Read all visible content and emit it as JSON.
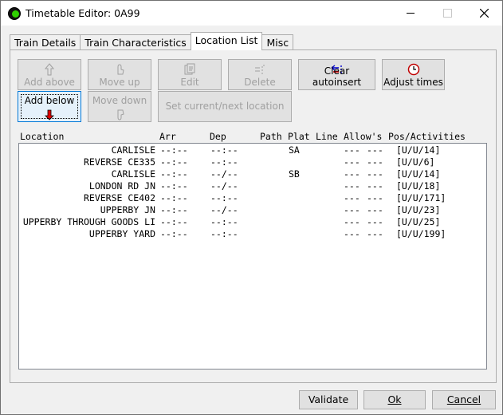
{
  "window": {
    "title": "Timetable Editor: 0A99"
  },
  "tabs": [
    {
      "label": "Train Details",
      "active": false
    },
    {
      "label": "Train Characteristics",
      "active": false
    },
    {
      "label": "Location List",
      "active": true
    },
    {
      "label": "Misc",
      "active": false
    }
  ],
  "toolbar": {
    "add_above": "Add above",
    "move_up": "Move up",
    "edit": "Edit",
    "delete": "Delete",
    "clear_autoinsert": "Clear autoinsert",
    "adjust_times": "Adjust times",
    "add_below": "Add below",
    "move_down": "Move down",
    "set_location": "Set current/next location"
  },
  "list": {
    "headers": {
      "location": "Location",
      "arr": "Arr",
      "dep": "Dep",
      "path": "Path",
      "plat": "Plat",
      "line": "Line",
      "allows": "Allow's",
      "pos": "Pos/Activities"
    },
    "rows": [
      {
        "location": "CARLISLE",
        "arr": "--:--",
        "dep": "--:--",
        "plat": "SA",
        "allow1": "---",
        "allow2": "---",
        "pos": "[U/U/14]"
      },
      {
        "location": "REVERSE CE335",
        "arr": "--:--",
        "dep": "--:--",
        "plat": "",
        "allow1": "---",
        "allow2": "---",
        "pos": "[U/U/6]"
      },
      {
        "location": "CARLISLE",
        "arr": "--:--",
        "dep": "--/--",
        "plat": "SB",
        "allow1": "---",
        "allow2": "---",
        "pos": "[U/U/14]"
      },
      {
        "location": "LONDON RD JN",
        "arr": "--:--",
        "dep": "--/--",
        "plat": "",
        "allow1": "---",
        "allow2": "---",
        "pos": "[U/U/18]"
      },
      {
        "location": "REVERSE CE402",
        "arr": "--:--",
        "dep": "--:--",
        "plat": "",
        "allow1": "---",
        "allow2": "---",
        "pos": "[U/U/171]"
      },
      {
        "location": "UPPERBY JN",
        "arr": "--:--",
        "dep": "--/--",
        "plat": "",
        "allow1": "---",
        "allow2": "---",
        "pos": "[U/U/23]"
      },
      {
        "location": "UPPERBY THROUGH GOODS LI",
        "arr": "--:--",
        "dep": "--:--",
        "plat": "",
        "allow1": "---",
        "allow2": "---",
        "pos": "[U/U/25]"
      },
      {
        "location": "UPPERBY YARD",
        "arr": "--:--",
        "dep": "--:--",
        "plat": "",
        "allow1": "---",
        "allow2": "---",
        "pos": "[U/U/199]"
      }
    ]
  },
  "footer": {
    "validate": "Validate",
    "ok": "Ok",
    "cancel": "Cancel"
  },
  "colors": {
    "accent": "#0078d7",
    "clear_icon_red": "#e00000",
    "clear_icon_blue": "#0000d0"
  }
}
